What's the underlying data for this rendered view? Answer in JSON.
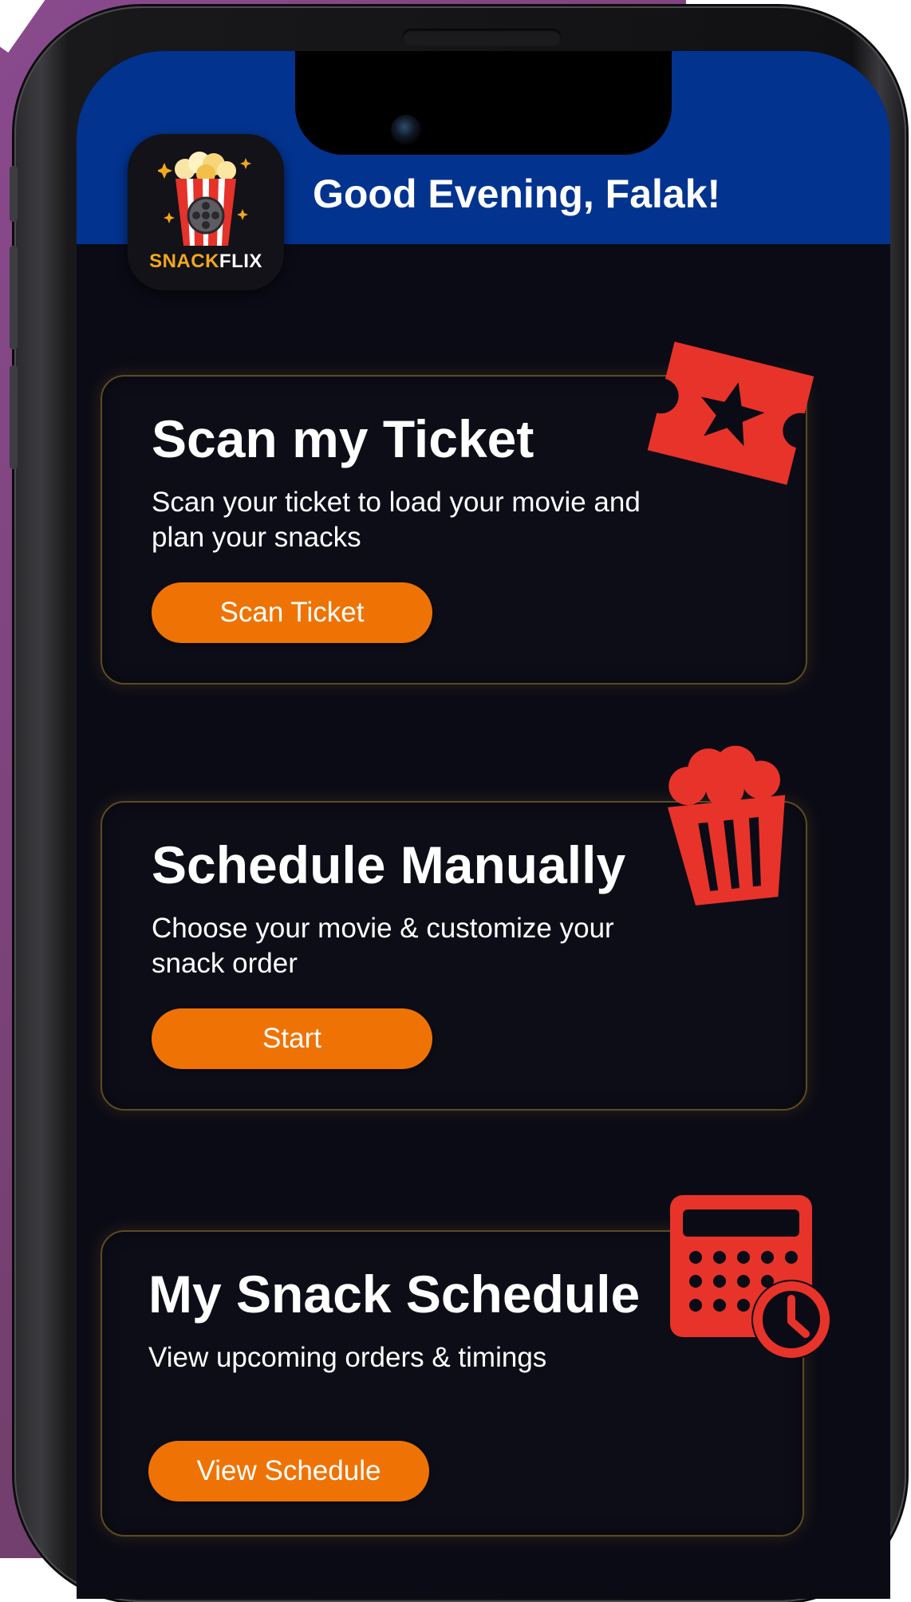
{
  "app": {
    "logo_text_part1": "SNACK",
    "logo_text_part2": "FLIX"
  },
  "header": {
    "greeting": "Good Evening, Falak!"
  },
  "cards": [
    {
      "title": "Scan my Ticket",
      "description": "Scan your ticket to load your movie and plan your snacks",
      "button_label": "Scan Ticket",
      "icon": "ticket-star-icon"
    },
    {
      "title": "Schedule Manually",
      "description": "Choose your movie & customize your snack order",
      "button_label": "Start",
      "icon": "popcorn-bucket-icon"
    },
    {
      "title": "My Snack Schedule",
      "description": "View upcoming orders & timings",
      "button_label": "View Schedule",
      "icon": "calendar-clock-icon"
    }
  ],
  "colors": {
    "header": "#02338f",
    "background": "#0b0b16",
    "accent": "#ef7304",
    "icon": "#e8332a",
    "card_border": "#5b4a24",
    "logo_gold": "#f2a81d"
  }
}
